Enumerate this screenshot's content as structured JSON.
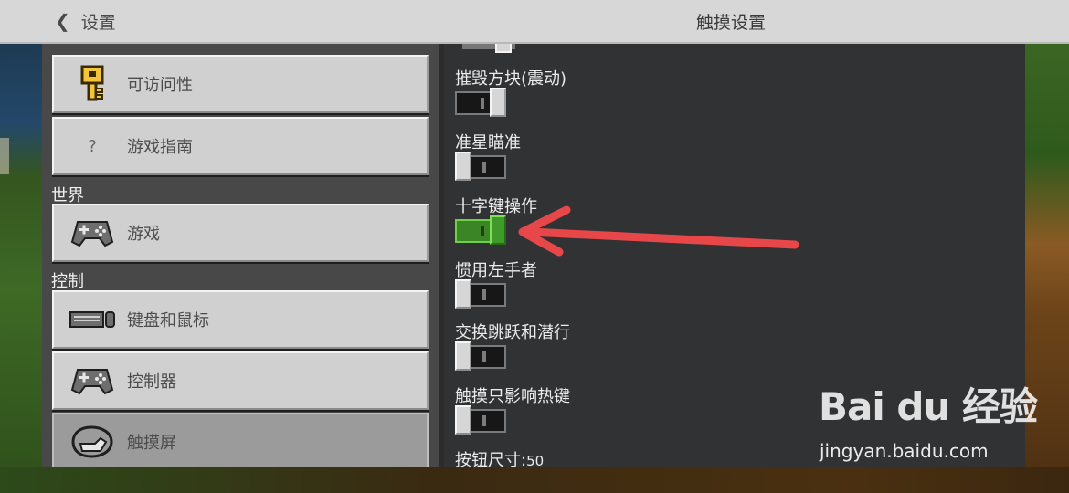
{
  "header": {
    "back_label": "设置",
    "title": "触摸设置"
  },
  "sidebar": {
    "items": [
      {
        "label": "可访问性",
        "icon": "key-icon"
      },
      {
        "label": "游戏指南",
        "icon": "question-icon",
        "glyph": "?"
      }
    ],
    "sections": [
      {
        "heading": "世界",
        "items": [
          {
            "label": "游戏",
            "icon": "controller-icon"
          }
        ]
      },
      {
        "heading": "控制",
        "items": [
          {
            "label": "键盘和鼠标",
            "icon": "keyboard-mouse-icon"
          },
          {
            "label": "控制器",
            "icon": "controller-icon"
          },
          {
            "label": "触摸屏",
            "icon": "touch-hand-icon",
            "selected": true
          }
        ]
      }
    ]
  },
  "settings": [
    {
      "label": "摧毁方块(震动)",
      "on": false
    },
    {
      "label": "准星瞄准",
      "on": false
    },
    {
      "label": "十字键操作",
      "on": true
    },
    {
      "label": "惯用左手者",
      "on": false
    },
    {
      "label": "交换跳跃和潜行",
      "on": false
    },
    {
      "label": "触摸只影响热键",
      "on": false
    }
  ],
  "button_size": {
    "label": "按钮尺寸:",
    "value": "50"
  },
  "annotation": {
    "arrow_color": "#e8474a"
  },
  "watermark": {
    "logo": "Bai du 经验",
    "url": "jingyan.baidu.com"
  },
  "colors": {
    "toggle_on": "#3c8527",
    "panel_right": "#313233",
    "panel_left": "#484848"
  }
}
